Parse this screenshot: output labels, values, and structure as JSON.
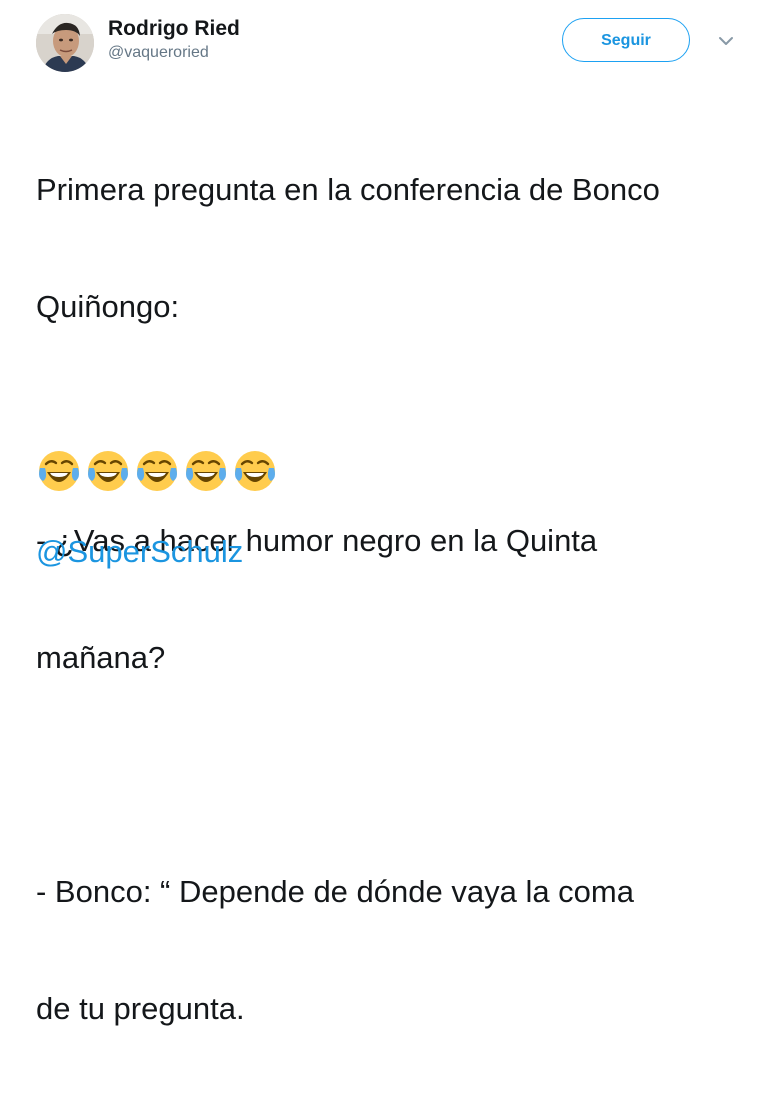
{
  "user": {
    "display_name": "Rodrigo Ried",
    "handle": "@vaqueroried"
  },
  "actions": {
    "follow_label": "Seguir",
    "menu_icon": "chevron-down-icon"
  },
  "tweet": {
    "lines": [
      "Primera pregunta en la conferencia de Bonco",
      "Quiñongo:",
      "",
      "- ¿Vas a hacer humor negro en la Quinta",
      "mañana?",
      "",
      "- Bonco: “ Depende de dónde vaya la coma",
      "de tu pregunta."
    ],
    "emoji": [
      "😂",
      "😂",
      "😂",
      "😂",
      "😂"
    ],
    "mention": "@SuperSchulz"
  },
  "colors": {
    "text": "#14171a",
    "secondary": "#657786",
    "accent": "#1da1f2",
    "link": "#1b95e0"
  }
}
